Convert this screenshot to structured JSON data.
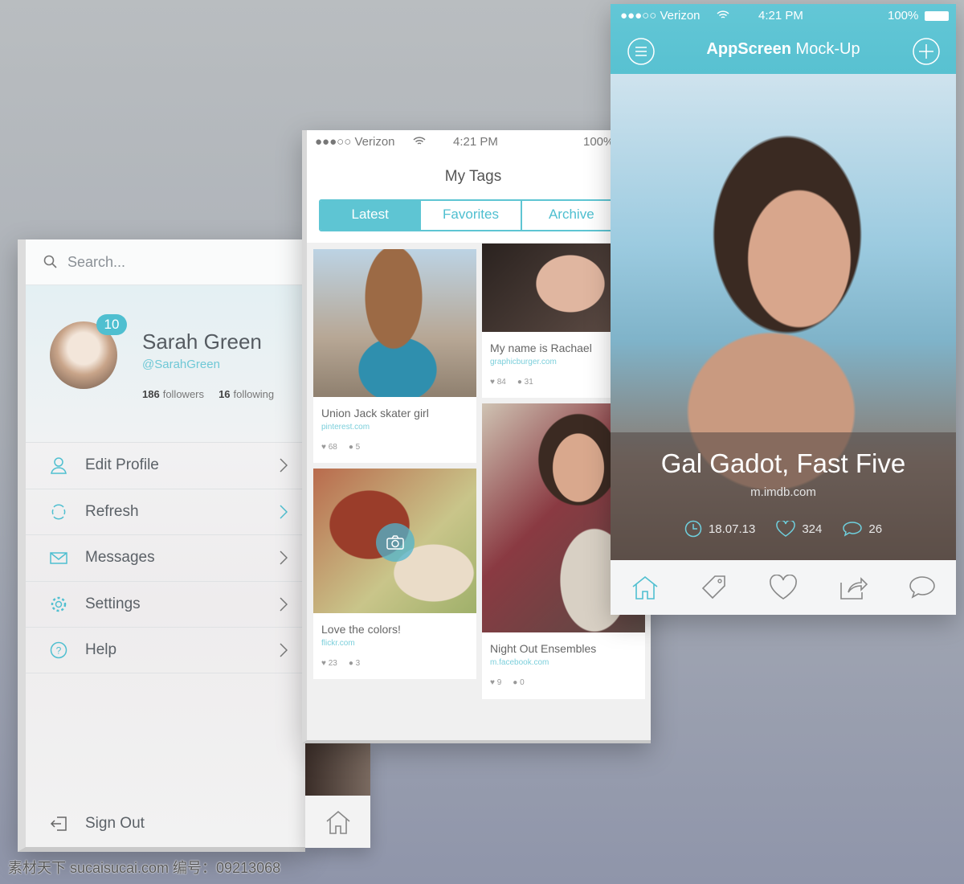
{
  "sidebar": {
    "search_placeholder": "Search...",
    "profile": {
      "name": "Sarah Green",
      "handle": "@SarahGreen",
      "notifications": "10",
      "followers_count": "186",
      "followers_label": "followers",
      "following_count": "16",
      "following_label": "following"
    },
    "items": [
      {
        "label": "Edit Profile",
        "icon": "user-icon"
      },
      {
        "label": "Refresh",
        "icon": "refresh-icon"
      },
      {
        "label": "Messages",
        "icon": "envelope-icon"
      },
      {
        "label": "Settings",
        "icon": "gear-icon"
      },
      {
        "label": "Help",
        "icon": "help-icon"
      }
    ],
    "sign_out": "Sign Out"
  },
  "tags_screen": {
    "status": {
      "carrier": "●●●○○ Verizon",
      "time": "4:21 PM",
      "battery": "100%"
    },
    "title": "My Tags",
    "tabs": [
      {
        "label": "Latest",
        "active": true
      },
      {
        "label": "Favorites"
      },
      {
        "label": "Archive"
      }
    ],
    "cards": [
      {
        "title": "Union Jack skater girl",
        "source": "pinterest.com",
        "likes": "68",
        "comments": "5"
      },
      {
        "title": "My name is Rachael",
        "source": "graphicburger.com",
        "likes": "84",
        "comments": "31"
      },
      {
        "title": "Love the colors!",
        "source": "flickr.com",
        "likes": "23",
        "comments": "3"
      },
      {
        "title": "Night Out Ensembles",
        "source": "m.facebook.com",
        "likes": "9",
        "comments": "0"
      }
    ]
  },
  "detail_screen": {
    "status": {
      "carrier": "●●●○○ Verizon",
      "time": "4:21 PM",
      "battery": "100%"
    },
    "title_bold": "AppScreen",
    "title_rest": " Mock-Up",
    "caption": {
      "title": "Gal Gadot, Fast Five",
      "source": "m.imdb.com",
      "date": "18.07.13",
      "likes": "324",
      "comments": "26"
    },
    "tabbar": [
      "home-icon",
      "tag-icon",
      "heart-icon",
      "share-icon",
      "comment-icon"
    ]
  },
  "watermark": "素材天下 sucaisucai.com  编号：09213068",
  "colors": {
    "accent": "#5ec5d3"
  }
}
